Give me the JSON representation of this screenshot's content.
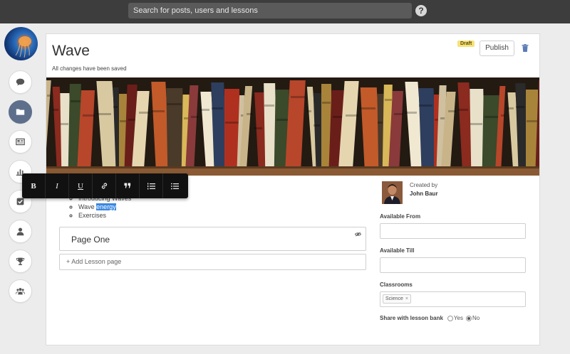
{
  "search": {
    "placeholder": "Search for posts, users and lessons"
  },
  "help_icon": "question-circle-icon",
  "sidebar": {
    "items": [
      {
        "name": "comments",
        "icon": "speech-bubble-icon",
        "active": false
      },
      {
        "name": "folder",
        "icon": "folder-icon",
        "active": true
      },
      {
        "name": "news",
        "icon": "newspaper-icon",
        "active": false
      },
      {
        "name": "stats",
        "icon": "bar-chart-icon",
        "active": false
      },
      {
        "name": "tasks",
        "icon": "checkbox-icon",
        "active": false
      },
      {
        "name": "profile",
        "icon": "user-icon",
        "active": false
      },
      {
        "name": "achievements",
        "icon": "trophy-icon",
        "active": false
      },
      {
        "name": "groups",
        "icon": "users-icon",
        "active": false
      }
    ]
  },
  "lesson": {
    "title": "Wave",
    "save_status": "All changes have been saved",
    "status_badge": "Draft",
    "publish_label": "Publish"
  },
  "editor": {
    "toolbar": [
      "B",
      "I",
      "U",
      "link",
      "quote",
      "ordered-list",
      "bullet-list"
    ],
    "contents": [
      {
        "text": "Introducing Waves",
        "highlight": ""
      },
      {
        "text": "Wave ",
        "highlight": "energy"
      },
      {
        "text": "Exercises",
        "highlight": ""
      }
    ]
  },
  "pages": [
    {
      "label": "Page One"
    }
  ],
  "add_page_label": "+ Add Lesson page",
  "author": {
    "created_by_label": "Created by",
    "name": "John Baur"
  },
  "fields": {
    "available_from": {
      "label": "Available From",
      "value": ""
    },
    "available_till": {
      "label": "Available Till",
      "value": ""
    },
    "classrooms": {
      "label": "Classrooms",
      "chips": [
        "Science"
      ]
    }
  },
  "share": {
    "label": "Share with lesson bank",
    "options": [
      {
        "label": "Yes",
        "checked": false
      },
      {
        "label": "No",
        "checked": true
      }
    ]
  },
  "colors": {
    "topbar": "#3d3d3d",
    "active_nav": "#5e6f8c",
    "selection": "#3b87e0",
    "draft_badge": "#f5e27a"
  }
}
